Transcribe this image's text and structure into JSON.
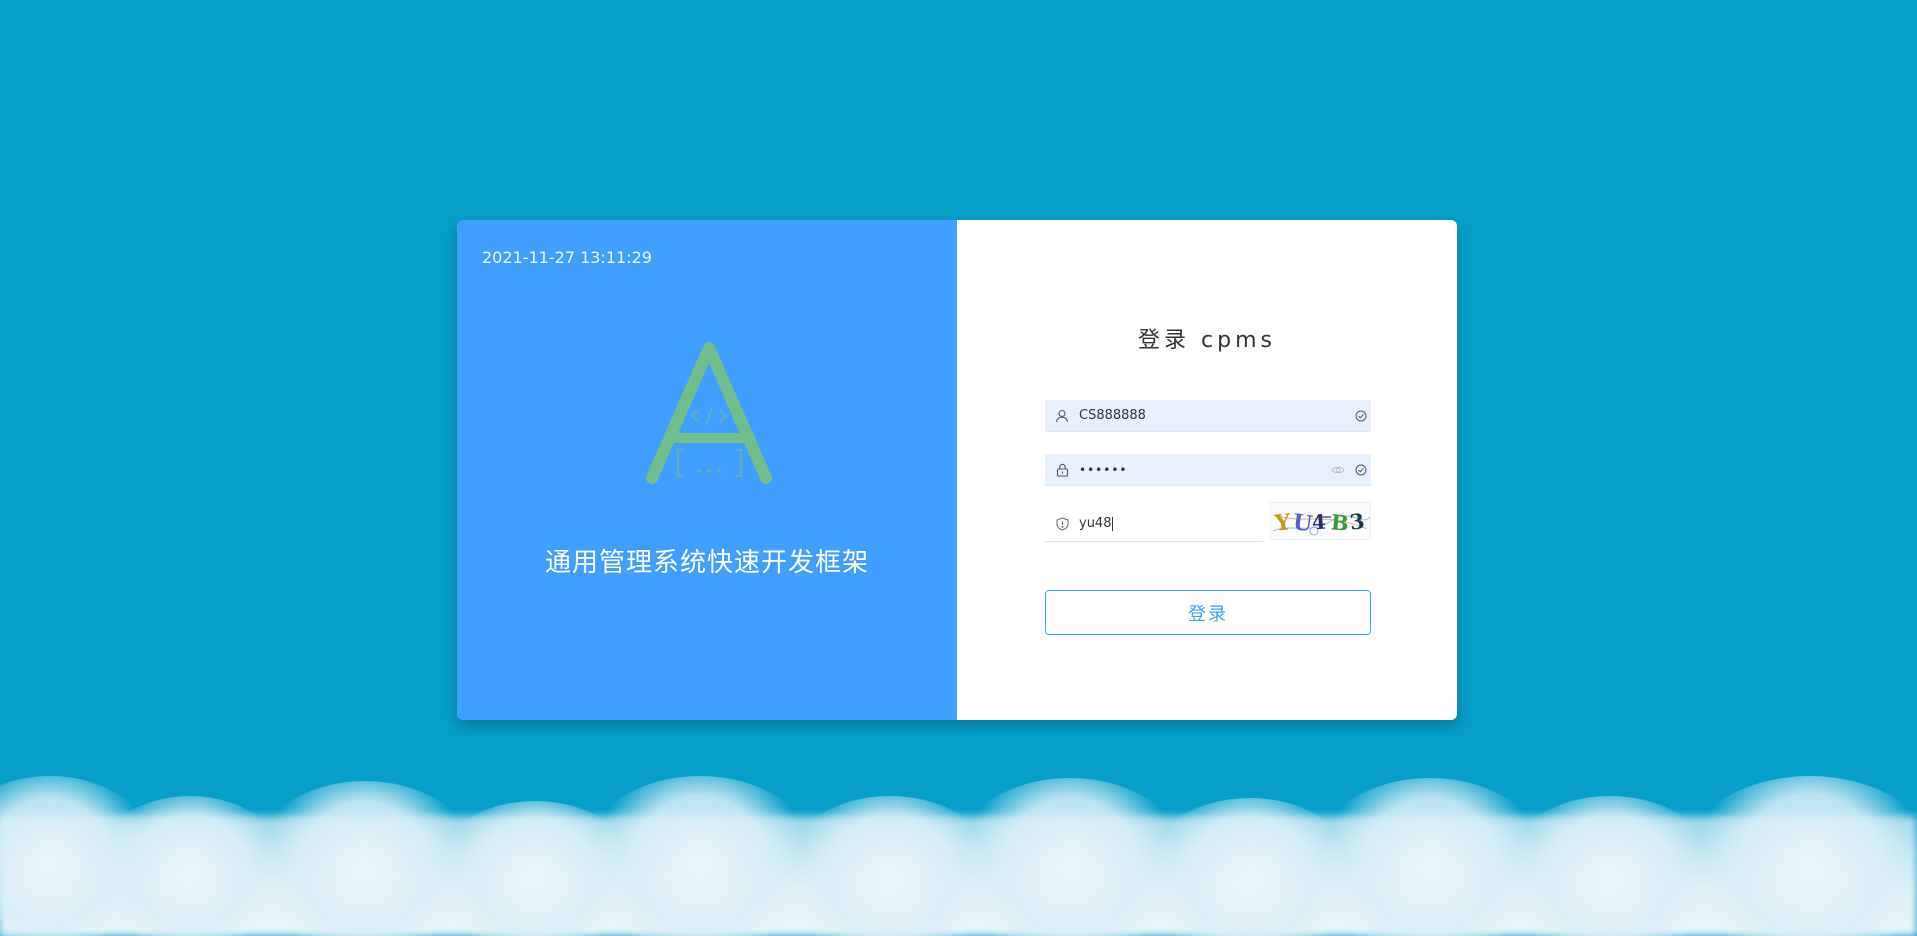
{
  "left_panel": {
    "datetime": "2021-11-27 13:11:29",
    "slogan": "通用管理系统快速开发框架"
  },
  "login_form": {
    "title": "登录 cpms",
    "username_value": "CS888888",
    "password_masked": "••••••",
    "code_value": "yu48",
    "captcha_text": "YU4B3",
    "submit_label": "登录"
  },
  "colors": {
    "background": "#079fca",
    "panel_blue": "#409eff",
    "logo_green": "#72bd8c",
    "autofill": "#e8f0fe"
  }
}
